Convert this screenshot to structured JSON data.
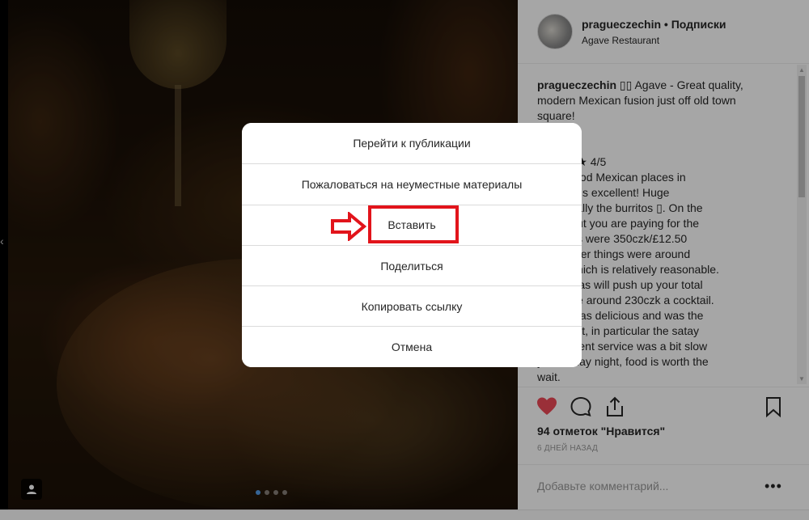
{
  "post": {
    "username": "pragueczechin",
    "separator": "•",
    "follow_label": "Подписки",
    "location": "Agave Restaurant",
    "caption_lines": [
      "modern Mexican fusion just off old town",
      "square!",
      "££",
      "s",
      "★ ★ ★ ★ 4/5",
      "e few good Mexican places in",
      "this one is excellent! Huge",
      ", especially the burritos ▯. On the",
      "e side but you are paying for the",
      ". Burritos were 350czk/£12.50",
      "most other things were around",
      "£8.90 which is relatively reasonable.",
      "margaritas will push up your total",
      "ese were around 230czk a cocktail.",
      "e food was delicious and was the",
      "lling point, in particular the satay",
      ". Be patient service was a bit slow",
      "y Saturday night, food is worth the",
      "wait."
    ],
    "caption_first_line": "▯▯ Agave - Great quality,",
    "likes_text": "94 отметок \"Нравится\"",
    "time_ago": "6 дней назад",
    "comment_placeholder": "Добавьте комментарий..."
  },
  "menu": {
    "items": [
      "Перейти к публикации",
      "Пожаловаться на неуместные материалы",
      "Вставить",
      "Поделиться",
      "Копировать ссылку",
      "Отмена"
    ],
    "highlighted_item": "Вставить"
  },
  "colors": {
    "heart_red": "#ed4956",
    "highlight_red": "#e2141b",
    "text_dark": "#262626",
    "text_muted": "#999999"
  },
  "icons": {
    "like": "heart-icon",
    "comment": "comment-icon",
    "share": "share-icon",
    "save": "bookmark-icon",
    "more": "more-icon",
    "tag": "user-tag-icon",
    "annotation_arrow": "arrow-right-icon"
  }
}
